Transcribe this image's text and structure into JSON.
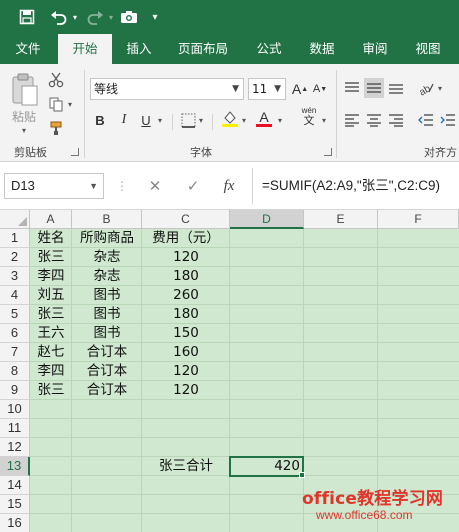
{
  "colors": {
    "brand": "#217346",
    "sheet_bg": "#cfe8cf",
    "watermark": "#e0352b",
    "font_color_swatch": "#e81123",
    "fill_color_swatch": "#ffef00"
  },
  "quick_access": [
    {
      "icon": "save-icon"
    },
    {
      "icon": "undo-icon"
    },
    {
      "icon": "redo-icon"
    },
    {
      "icon": "camera-icon"
    },
    {
      "icon": "customize-toolbar-icon"
    }
  ],
  "tabs": [
    "文件",
    "开始",
    "插入",
    "页面布局",
    "公式",
    "数据",
    "审阅",
    "视图"
  ],
  "active_tab": "开始",
  "ribbon": {
    "clipboard": {
      "paste_label": "粘贴",
      "group_label": "剪贴板"
    },
    "font": {
      "font_name": "等线",
      "font_size": "11",
      "group_label": "字体",
      "bold": "B",
      "italic": "I",
      "underline": "U",
      "phonetic": "wén"
    },
    "alignment": {
      "group_label": "对齐方"
    }
  },
  "formula_bar": {
    "name_box": "D13",
    "cancel": "✕",
    "enter": "✓",
    "fx": "fx",
    "formula": "=SUMIF(A2:A9,\"张三\",C2:C9)"
  },
  "columns": [
    "A",
    "B",
    "C",
    "D",
    "E",
    "F"
  ],
  "selected_column": "D",
  "rows": [
    "1",
    "2",
    "3",
    "4",
    "5",
    "6",
    "7",
    "8",
    "9",
    "10",
    "11",
    "12",
    "13",
    "14",
    "15",
    "16"
  ],
  "selected_row": "13",
  "table": {
    "header": [
      "姓名",
      "所购商品",
      "费用（元）"
    ],
    "data": [
      [
        "张三",
        "杂志",
        "120"
      ],
      [
        "李四",
        "杂志",
        "180"
      ],
      [
        "刘五",
        "图书",
        "260"
      ],
      [
        "张三",
        "图书",
        "180"
      ],
      [
        "王六",
        "图书",
        "150"
      ],
      [
        "赵七",
        "合订本",
        "160"
      ],
      [
        "李四",
        "合订本",
        "120"
      ],
      [
        "张三",
        "合订本",
        "120"
      ]
    ]
  },
  "summary": {
    "label": "张三合计",
    "value": "420"
  },
  "watermark": {
    "line1": "office教程学习网",
    "line2": "www.office68.com"
  }
}
